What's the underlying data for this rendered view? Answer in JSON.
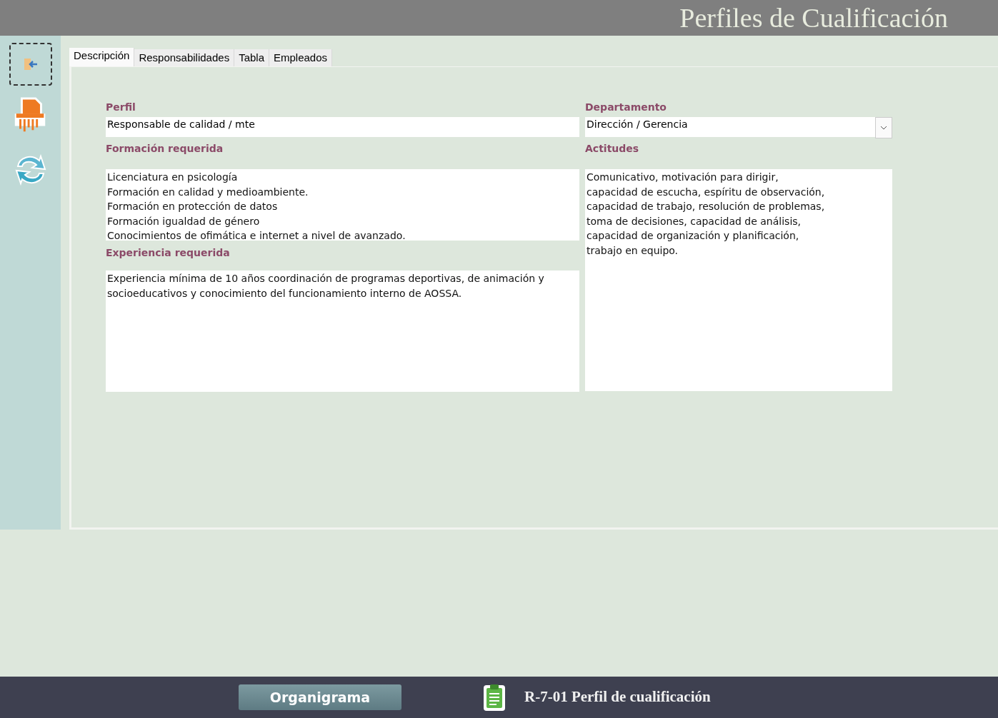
{
  "header": {
    "title": "Perfiles de Cualificación"
  },
  "sidebar": {
    "buttons": [
      {
        "kind": "exit",
        "selected": true
      },
      {
        "kind": "shredder",
        "selected": false
      },
      {
        "kind": "refresh",
        "selected": false
      }
    ]
  },
  "tabs": [
    {
      "label": "Descripción",
      "selected": true
    },
    {
      "label": "Responsabilidades",
      "selected": false
    },
    {
      "label": "Tabla",
      "selected": false
    },
    {
      "label": "Empleados",
      "selected": false
    }
  ],
  "form": {
    "perfil": {
      "label": "Perfil",
      "value": "Responsable de calidad / mte"
    },
    "departamento": {
      "label": "Departamento",
      "value": "Dirección / Gerencia"
    },
    "formacion": {
      "label": "Formación requerida",
      "value": "Licenciatura en psicología\nFormación en calidad y medioambiente.\nFormación en protección de datos\nFormación igualdad de género\nConocimientos de ofimática e internet a nivel de avanzado."
    },
    "actitudes": {
      "label": "Actitudes",
      "value": "Comunicativo, motivación para dirigir,\ncapacidad de escucha, espíritu de observación,\ncapacidad de trabajo, resolución de problemas,\ntoma de decisiones, capacidad de análisis,\ncapacidad de organización y planificación,\ntrabajo en equipo."
    },
    "experiencia": {
      "label": "Experiencia requerida",
      "value": "Experiencia mínima de 10 años coordinación de programas deportivas, de animación y socioeducativos y conocimiento del funcionamiento interno de AOSSA."
    }
  },
  "footer": {
    "button": "Organigrama",
    "document": "R-7-01 Perfil de cualificación"
  }
}
